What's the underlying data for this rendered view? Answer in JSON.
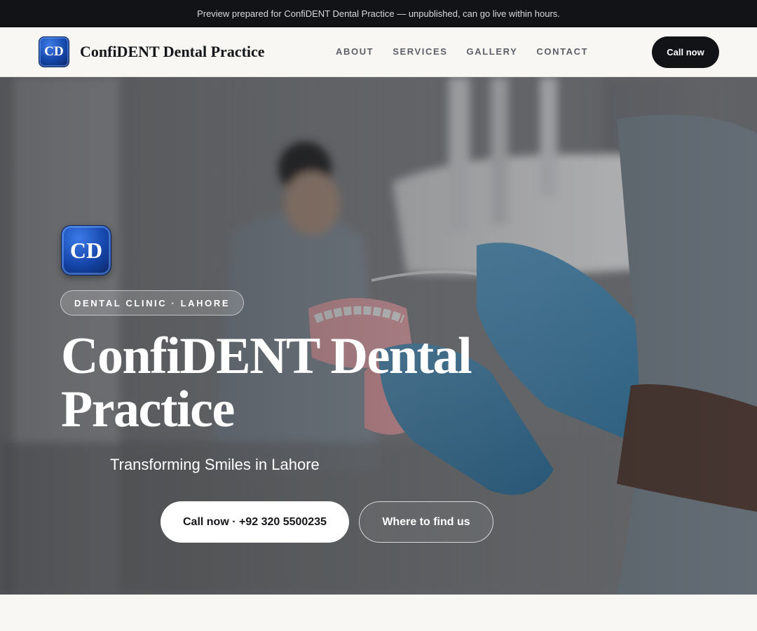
{
  "preview_banner": "Preview prepared for ConfiDENT Dental Practice — unpublished, can go live within hours.",
  "brand": {
    "logo_text": "CD",
    "name": "ConfiDENT Dental Practice"
  },
  "nav": {
    "items": [
      "ABOUT",
      "SERVICES",
      "GALLERY",
      "CONTACT"
    ],
    "cta_label": "Call now"
  },
  "hero": {
    "logo_text": "CD",
    "badge": "DENTAL CLINIC · LAHORE",
    "title": "ConfiDENT Dental Practice",
    "subtitle": "Transforming Smiles in Lahore",
    "primary_cta": "Call now · +92 320 5500235",
    "secondary_cta": "Where to find us"
  },
  "colors": {
    "dark": "#121317",
    "brand_blue": "#1446a8",
    "page_bg": "#f8f7f4"
  }
}
